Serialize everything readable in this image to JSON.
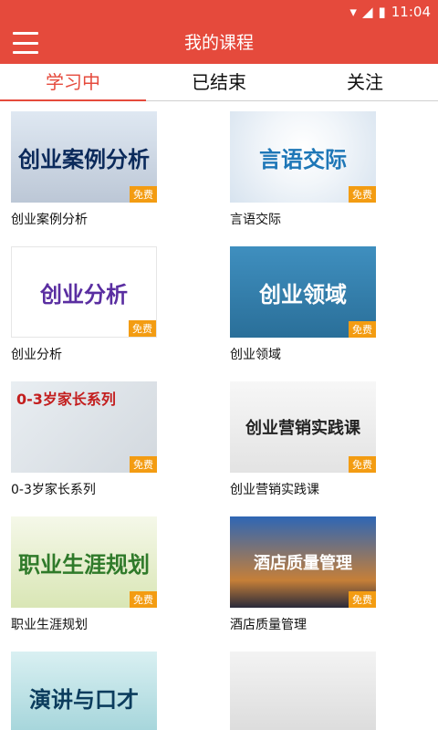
{
  "status": {
    "time": "11:04"
  },
  "app": {
    "title": "我的课程"
  },
  "tabs": [
    {
      "label": "学习中",
      "active": true
    },
    {
      "label": "已结束",
      "active": false
    },
    {
      "label": "关注",
      "active": false
    }
  ],
  "courses": [
    {
      "title": "创业案例分析",
      "thumb_text": "创业案例分析",
      "badge": "免费"
    },
    {
      "title": "言语交际",
      "thumb_text": "言语交际",
      "badge": "免费"
    },
    {
      "title": "创业分析",
      "thumb_text": "创业分析",
      "badge": "免费"
    },
    {
      "title": "创业领域",
      "thumb_text": "创业领域",
      "badge": "免费"
    },
    {
      "title": "0-3岁家长系列",
      "thumb_text": "0-3岁家长系列",
      "badge": "免费"
    },
    {
      "title": "创业营销实践课",
      "thumb_text": "创业营销实践课",
      "badge": "免费"
    },
    {
      "title": "职业生涯规划",
      "thumb_text": "职业生涯规划",
      "badge": "免费"
    },
    {
      "title": "酒店质量管理",
      "thumb_text": "酒店质量管理",
      "badge": "免费"
    },
    {
      "title": "演讲与口才",
      "thumb_text": "演讲与口才",
      "badge": ""
    },
    {
      "title": "",
      "thumb_text": "",
      "badge": ""
    }
  ],
  "colors": {
    "primary": "#e54a3c",
    "badge": "#f39c12"
  }
}
